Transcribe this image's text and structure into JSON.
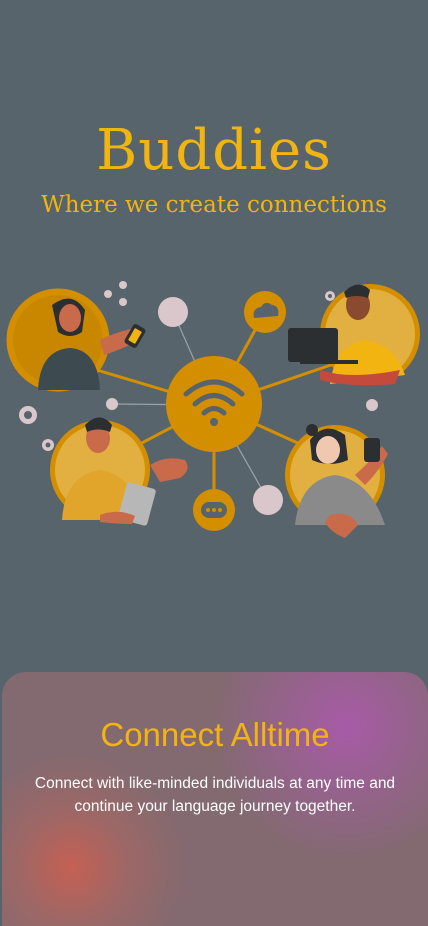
{
  "header": {
    "title": "Buddies",
    "tagline": "Where we create connections"
  },
  "illustration": {
    "hub_icon": "wifi-icon",
    "icons": [
      "cloud-icon",
      "chat-bubble-icon",
      "gear-icon"
    ],
    "people": [
      "person-with-phone",
      "person-with-laptop",
      "person-with-tablet",
      "person-texting"
    ]
  },
  "card": {
    "title": "Connect Alltime",
    "description": "Connect with like-minded individuals at any time and continue your language journey together."
  },
  "colors": {
    "background": "#58646b",
    "accent": "#f2b410",
    "hub": "#d48f00",
    "card": "#826a70"
  }
}
